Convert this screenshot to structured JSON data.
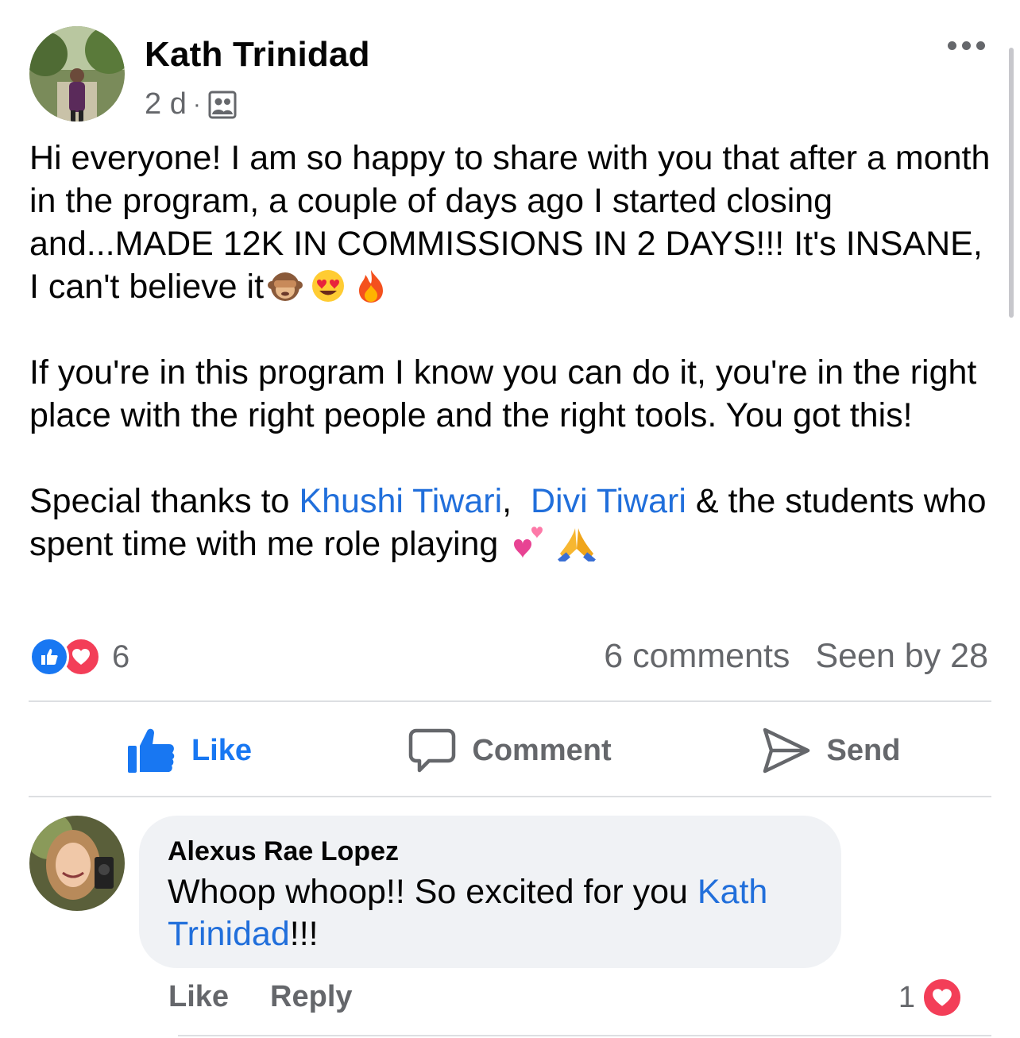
{
  "post": {
    "author": "Kath Trinidad",
    "time": "2 d",
    "separator": "·",
    "audience_icon": "group-members-icon",
    "body": {
      "p1": "Hi everyone! I am so happy to share with you that after a month in the program, a couple of days ago I started closing and...MADE 12K IN COMMISSIONS IN 2 DAYS!!! It's INSANE, I can't believe it",
      "p1_emojis": [
        "see-no-evil-monkey",
        "heart-eyes",
        "fire"
      ],
      "p2": "If you're in this program I know you can do it, you're in the right place with the right people and the right tools. You got this!",
      "p3_start": "Special thanks to ",
      "mention1": "Khushi Tiwari",
      "p3_sep": ",  ",
      "mention2": "Divi Tiwari",
      "p3_end": " & the students who spent time with me role playing ",
      "p3_emojis": [
        "two-hearts",
        "folded-hands"
      ]
    },
    "reactions": {
      "types": [
        "like",
        "love"
      ],
      "count": "6"
    },
    "comments_count": "6 comments",
    "seen_by": "Seen by 28"
  },
  "actions": {
    "like": "Like",
    "comment": "Comment",
    "send": "Send"
  },
  "comment": {
    "author": "Alexus Rae Lopez",
    "text_start": "Whoop whoop!! So excited for you ",
    "mention": "Kath Trinidad",
    "text_end": "!!!",
    "like_label": "Like",
    "reply_label": "Reply",
    "reaction_count": "1",
    "reaction_type": "love"
  },
  "colors": {
    "accent": "#1877f2",
    "mention": "#216fdb",
    "love": "#f33e58",
    "muted": "#65676b",
    "bubble": "#f0f2f5"
  }
}
